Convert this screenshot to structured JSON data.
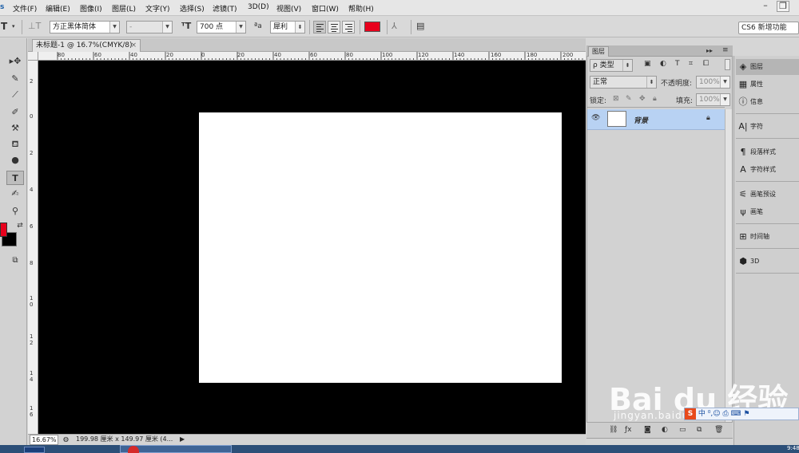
{
  "menu": {
    "items": [
      "文件(F)",
      "编辑(E)",
      "图像(I)",
      "图层(L)",
      "文字(Y)",
      "选择(S)",
      "滤镜(T)",
      "3D(D)",
      "视图(V)",
      "窗口(W)",
      "帮助(H)"
    ],
    "workspace": "CS6 新增功能",
    "minimize": "–",
    "restore": "❐"
  },
  "options": {
    "font_family": "方正黑体简体",
    "font_style": "-",
    "font_size": "700 点",
    "aa_label": "ªa",
    "antialias": "犀利",
    "text_color": "#e8001c"
  },
  "document": {
    "tab_title": "未标题-1 @ 16.7%(CMYK/8)",
    "tab_close": "×",
    "ruler_top": [
      "80",
      "60",
      "40",
      "20",
      "0",
      "20",
      "40",
      "60",
      "80",
      "100",
      "120",
      "140",
      "160",
      "180",
      "200"
    ],
    "ruler_left": [
      "2",
      "0",
      "2",
      "4",
      "6",
      "8",
      "10",
      "12",
      "14",
      "16"
    ]
  },
  "status": {
    "zoom": "16.67%",
    "doc_info": "199.98 厘米 x 149.97 厘米 (4...",
    "arrow": "▶"
  },
  "layers_panel": {
    "tab": "图层",
    "filter_label": "ρ 类型",
    "blend_mode": "正常",
    "opacity_label": "不透明度:",
    "opacity_value": "100%",
    "lock_label": "锁定:",
    "fill_label": "填充:",
    "fill_value": "100%",
    "layer_name": "背景",
    "collapse": "▸▸",
    "menu_icon": "≡"
  },
  "dock": {
    "items": [
      "图层",
      "属性",
      "信息",
      "字符",
      "段落样式",
      "字符样式",
      "画笔预设",
      "画笔",
      "时间轴",
      "3D"
    ]
  },
  "colors": {
    "foreground": "#e8001c",
    "background": "#000000"
  },
  "watermark": {
    "text": "Bai du 经验",
    "sub": "jingyan.baidu.com"
  },
  "clock": "9:48"
}
